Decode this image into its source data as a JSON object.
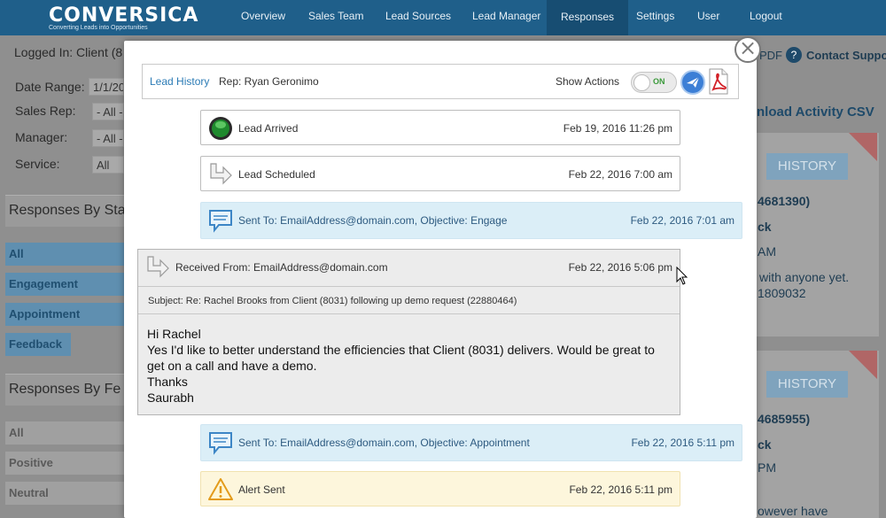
{
  "app": {
    "logo": "CONVERSICA",
    "tagline": "Converting Leads into Opportunities"
  },
  "nav": {
    "items": [
      "Overview",
      "Sales Team",
      "Lead Sources",
      "Lead Manager",
      "Responses",
      "Settings",
      "User",
      "Logout"
    ],
    "active": "Responses"
  },
  "background": {
    "logged_in": "Logged In: Client (8",
    "filters": {
      "date_range_label": "Date Range:",
      "date_range_value": "1/1/20",
      "sales_rep_label": "Sales Rep:",
      "sales_rep_value": "- All -",
      "manager_label": "Manager:",
      "manager_value": "- All -",
      "service_label": "Service:",
      "service_value": "All"
    },
    "section_status": "Responses By Sta",
    "status_tabs": [
      "All",
      "Engagement",
      "Appointment",
      "Feedback"
    ],
    "section_feedback": "Responses By Fe",
    "feedback_tabs": [
      "All",
      "Positive",
      "Neutral"
    ],
    "right": {
      "pdf": "PDF",
      "contact_support": "Contact Suppor",
      "download": "nload Activity CSV",
      "card1": {
        "history": "HISTORY",
        "id": "4681390)",
        "line1": "ck",
        "line2": "AM",
        "line3": "with anyone yet.",
        "line4": "1809032"
      },
      "card2": {
        "history": "HISTORY",
        "id": "4685955)",
        "line1": "ck",
        "line2": "PM",
        "line3": "owever have"
      }
    }
  },
  "modal": {
    "lead_history_link": "Lead History",
    "rep": "Rep: Ryan Geronimo",
    "show_actions": "Show Actions",
    "toggle_state": "ON",
    "events": [
      {
        "type": "arrived",
        "title": "Lead Arrived",
        "date": "Feb 19, 2016 11:26 pm"
      },
      {
        "type": "scheduled",
        "title": "Lead Scheduled",
        "date": "Feb 22, 2016 7:00 am"
      },
      {
        "type": "sent",
        "title": "Sent To: EmailAddress@domain.com, Objective: Engage",
        "date": "Feb 22, 2016 7:01 am"
      },
      {
        "type": "sent",
        "title": "Sent To: EmailAddress@domain.com, Objective: Appointment",
        "date": "Feb 22, 2016 5:11 pm"
      },
      {
        "type": "alert",
        "title": "Alert Sent",
        "date": "Feb 22, 2016 5:11 pm"
      }
    ],
    "received": {
      "title": "Received From: EmailAddress@domain.com",
      "date": "Feb 22, 2016 5:06 pm",
      "subject": "Subject: Re: Rachel Brooks from Client (8031) following up demo request (22880464)",
      "body": [
        "Hi Rachel",
        "Yes I'd like to better understand the efficiencies that Client (8031) delivers. Would be great to get on a call and have a demo.",
        "Thanks",
        "Saurabh"
      ]
    }
  }
}
